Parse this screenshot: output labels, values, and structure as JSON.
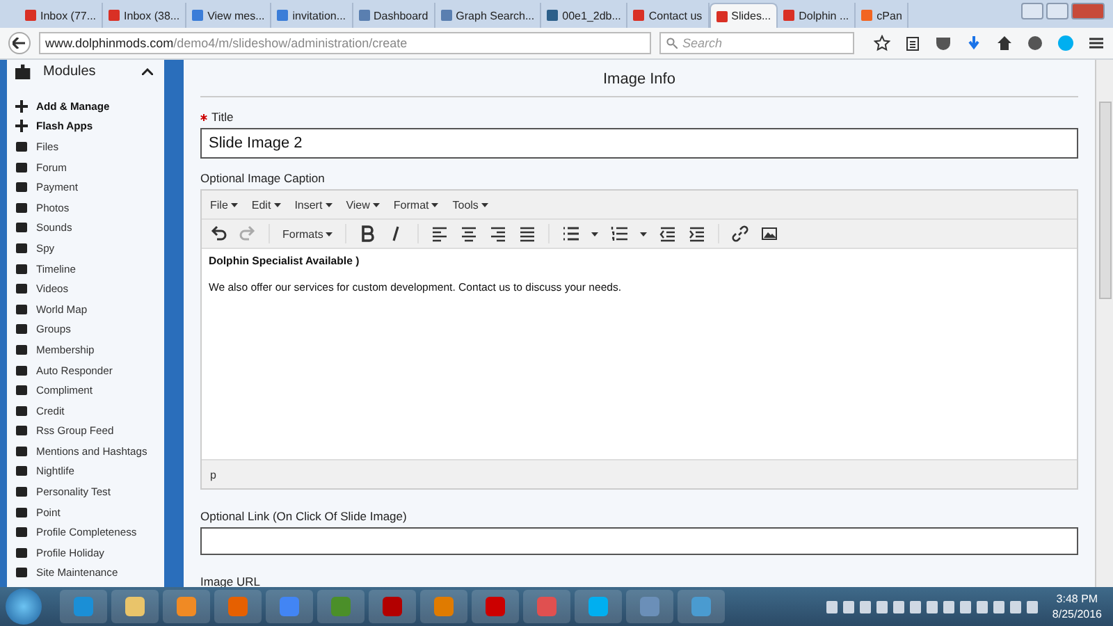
{
  "browser": {
    "tabs": [
      {
        "label": "Inbox (77...",
        "selected": false
      },
      {
        "label": "Inbox (38...",
        "selected": false
      },
      {
        "label": "View mes...",
        "selected": false
      },
      {
        "label": "invitation...",
        "selected": false
      },
      {
        "label": "Dashboard",
        "selected": false
      },
      {
        "label": "Graph Search...",
        "selected": false
      },
      {
        "label": "00e1_2db...",
        "selected": false
      },
      {
        "label": "Contact us",
        "selected": false
      },
      {
        "label": "Slides...",
        "selected": true
      },
      {
        "label": "Dolphin ...",
        "selected": false
      },
      {
        "label": "cPan",
        "selected": false
      }
    ],
    "url": {
      "host": "www.dolphinmods.com",
      "path": "/demo4/m/slideshow/administration/create"
    },
    "search": {
      "placeholder": "Search"
    }
  },
  "sidebar": {
    "title": "Modules",
    "expanded": true,
    "items": [
      {
        "label": "Add & Manage",
        "kind": "action"
      },
      {
        "label": "Flash Apps",
        "kind": "action"
      },
      {
        "label": "Files",
        "kind": "module"
      },
      {
        "label": "Forum",
        "kind": "module"
      },
      {
        "label": "Payment",
        "kind": "module"
      },
      {
        "label": "Photos",
        "kind": "module"
      },
      {
        "label": "Sounds",
        "kind": "module"
      },
      {
        "label": "Spy",
        "kind": "module"
      },
      {
        "label": "Timeline",
        "kind": "module"
      },
      {
        "label": "Videos",
        "kind": "module"
      },
      {
        "label": "World Map",
        "kind": "module"
      },
      {
        "label": "Groups",
        "kind": "module"
      },
      {
        "label": "Membership",
        "kind": "module"
      },
      {
        "label": "Auto Responder",
        "kind": "module"
      },
      {
        "label": "Compliment",
        "kind": "module"
      },
      {
        "label": "Credit",
        "kind": "module"
      },
      {
        "label": "Rss Group Feed",
        "kind": "module"
      },
      {
        "label": "Mentions and Hashtags",
        "kind": "module"
      },
      {
        "label": "Nightlife",
        "kind": "module"
      },
      {
        "label": "Personality Test",
        "kind": "module"
      },
      {
        "label": "Point",
        "kind": "module"
      },
      {
        "label": "Profile Completeness",
        "kind": "module"
      },
      {
        "label": "Profile Holiday",
        "kind": "module"
      },
      {
        "label": "Site Maintenance",
        "kind": "module"
      }
    ]
  },
  "form": {
    "heading": "Image Info",
    "title_field": {
      "label": "Title",
      "required": true,
      "value": "Slide Image 2"
    },
    "caption": {
      "label": "Optional Image Caption",
      "menus": [
        "File",
        "Edit",
        "Insert",
        "View",
        "Format",
        "Tools"
      ],
      "formats": "Formats",
      "heading": "Dolphin Specialist Available )",
      "body": "We also offer our services for custom development. Contact us to discuss your needs.",
      "path": "p"
    },
    "link_field": {
      "label": "Optional Link (On Click Of Slide Image)"
    },
    "next_label": "Image URL"
  },
  "taskbar": {
    "time": "3:48 PM",
    "date": "8/25/2016"
  }
}
